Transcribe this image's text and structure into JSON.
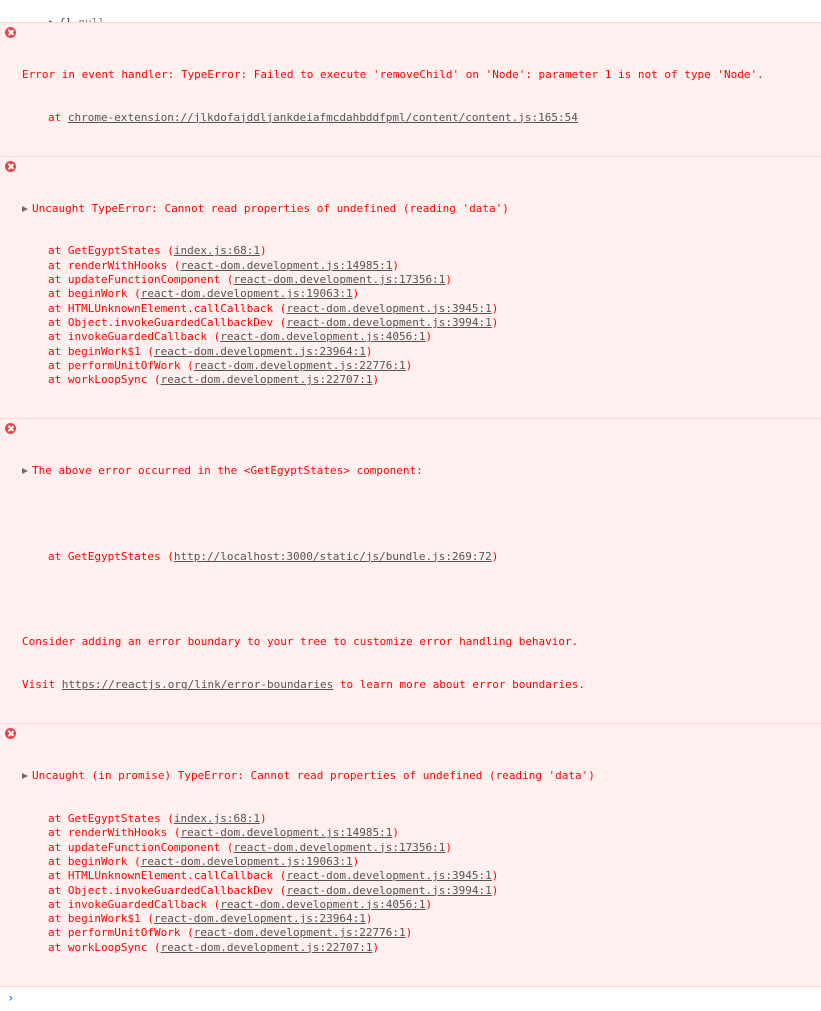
{
  "log_row": {
    "brace": "{}",
    "value": "null"
  },
  "messages": [
    {
      "kind": "error",
      "expandable": false,
      "text": "Error in event handler: TypeError: Failed to execute 'removeChild' on 'Node': parameter 1 is not of type 'Node'.",
      "frames": [
        {
          "at": "at ",
          "fn": "",
          "link": "chrome-extension://jlkdofajddljankdeiafmcdahbddfpml/content/content.js:165:54",
          "paren": false
        }
      ]
    },
    {
      "kind": "error",
      "expandable": true,
      "text": "Uncaught TypeError: Cannot read properties of undefined (reading 'data')",
      "frames": [
        {
          "at": "at ",
          "fn": "GetEgyptStates",
          "link": "index.js:68:1",
          "paren": true
        },
        {
          "at": "at ",
          "fn": "renderWithHooks",
          "link": "react-dom.development.js:14985:1",
          "paren": true
        },
        {
          "at": "at ",
          "fn": "updateFunctionComponent",
          "link": "react-dom.development.js:17356:1",
          "paren": true
        },
        {
          "at": "at ",
          "fn": "beginWork",
          "link": "react-dom.development.js:19063:1",
          "paren": true
        },
        {
          "at": "at ",
          "fn": "HTMLUnknownElement.callCallback",
          "link": "react-dom.development.js:3945:1",
          "paren": true
        },
        {
          "at": "at ",
          "fn": "Object.invokeGuardedCallbackDev",
          "link": "react-dom.development.js:3994:1",
          "paren": true
        },
        {
          "at": "at ",
          "fn": "invokeGuardedCallback",
          "link": "react-dom.development.js:4056:1",
          "paren": true
        },
        {
          "at": "at ",
          "fn": "beginWork$1",
          "link": "react-dom.development.js:23964:1",
          "paren": true
        },
        {
          "at": "at ",
          "fn": "performUnitOfWork",
          "link": "react-dom.development.js:22776:1",
          "paren": true
        },
        {
          "at": "at ",
          "fn": "workLoopSync",
          "link": "react-dom.development.js:22707:1",
          "paren": true
        }
      ]
    },
    {
      "kind": "error",
      "expandable": true,
      "text": "The above error occurred in the <GetEgyptStates> component:",
      "component_frame": {
        "at": "at ",
        "fn": "GetEgyptStates",
        "link": "http://localhost:3000/static/js/bundle.js:269:72"
      },
      "advice_line1": "Consider adding an error boundary to your tree to customize error handling behavior.",
      "advice_line2_prefix": "Visit ",
      "advice_link": "https://reactjs.org/link/error-boundaries",
      "advice_line2_suffix": " to learn more about error boundaries."
    },
    {
      "kind": "error",
      "expandable": true,
      "text": "Uncaught (in promise) TypeError: Cannot read properties of undefined (reading 'data')",
      "frames": [
        {
          "at": "at ",
          "fn": "GetEgyptStates",
          "link": "index.js:68:1",
          "paren": true
        },
        {
          "at": "at ",
          "fn": "renderWithHooks",
          "link": "react-dom.development.js:14985:1",
          "paren": true
        },
        {
          "at": "at ",
          "fn": "updateFunctionComponent",
          "link": "react-dom.development.js:17356:1",
          "paren": true
        },
        {
          "at": "at ",
          "fn": "beginWork",
          "link": "react-dom.development.js:19063:1",
          "paren": true
        },
        {
          "at": "at ",
          "fn": "HTMLUnknownElement.callCallback",
          "link": "react-dom.development.js:3945:1",
          "paren": true
        },
        {
          "at": "at ",
          "fn": "Object.invokeGuardedCallbackDev",
          "link": "react-dom.development.js:3994:1",
          "paren": true
        },
        {
          "at": "at ",
          "fn": "invokeGuardedCallback",
          "link": "react-dom.development.js:4056:1",
          "paren": true
        },
        {
          "at": "at ",
          "fn": "beginWork$1",
          "link": "react-dom.development.js:23964:1",
          "paren": true
        },
        {
          "at": "at ",
          "fn": "performUnitOfWork",
          "link": "react-dom.development.js:22776:1",
          "paren": true
        },
        {
          "at": "at ",
          "fn": "workLoopSync",
          "link": "react-dom.development.js:22707:1",
          "paren": true
        }
      ]
    }
  ],
  "prompt": {
    "symbol": "›"
  },
  "colors": {
    "error_text": "#ff0000",
    "error_bg": "#fff0f0",
    "error_border": "#ffd6d6",
    "error_icon": "#e8454b",
    "prompt": "#2c7dd8"
  }
}
